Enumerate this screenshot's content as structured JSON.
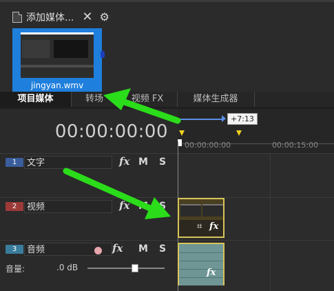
{
  "media_panel": {
    "tab_label": "添加媒体...",
    "close_glyph": "✕",
    "gear_glyph": "⚙",
    "thumbnail": {
      "filename": "jingyan.wmv"
    }
  },
  "bottom_tabs": [
    {
      "label": "项目媒体",
      "active": true
    },
    {
      "label": "转场",
      "active": false
    },
    {
      "label": "视频 FX",
      "active": false
    },
    {
      "label": "媒体生成器",
      "active": false
    }
  ],
  "timeline": {
    "timecode": "00:00:00:00",
    "loop_length": "+7:13",
    "ruler_labels": [
      "00:00:00:00",
      "00:00:15:00"
    ]
  },
  "tracks": [
    {
      "number": "1",
      "name": "文字",
      "number_color": "#3a5e9c",
      "fx": "fx",
      "mute": "M",
      "solo": "S"
    },
    {
      "number": "2",
      "name": "视频",
      "number_color": "#9c3a3a",
      "fx": "fx",
      "mute": "M",
      "solo": "S"
    },
    {
      "number": "3",
      "name": "音频",
      "number_color": "#3a7c9c",
      "fx": "fx",
      "mute": "M",
      "solo": "S",
      "volume_label": "音量:",
      "volume_value": ".0 dB"
    }
  ],
  "clips": {
    "video_fx": "fx",
    "audio_fx": "fx",
    "crop_glyph": "⌗"
  },
  "colors": {
    "thumbnail_bg": "#1f7fdc",
    "annotation_arrow": "#2bdc1a",
    "clip_border": "#d9c45a"
  }
}
